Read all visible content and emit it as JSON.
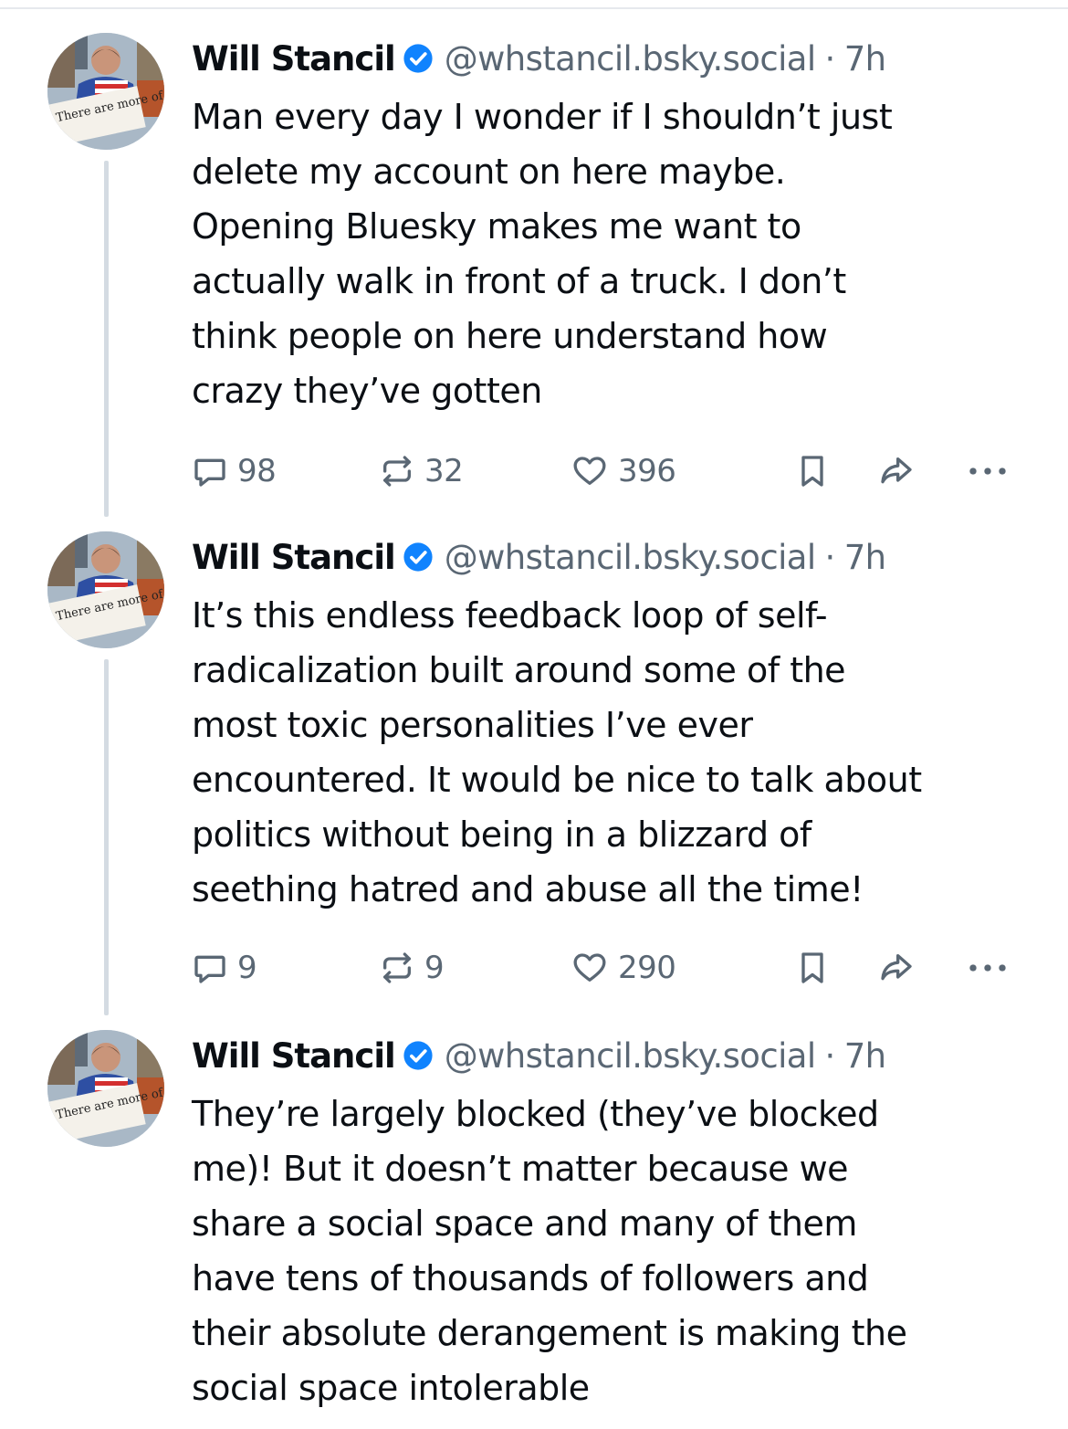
{
  "colors": {
    "text": "#0b0f14",
    "muted": "#5a6774",
    "verified_badge": "#1083fe",
    "thread_line": "#d4dbe2"
  },
  "avatar": {
    "sign_text": "There are more of us than them"
  },
  "icons": {
    "verified": "verified-check-icon",
    "reply": "reply-bubble-icon",
    "repost": "repost-arrows-icon",
    "like": "heart-icon",
    "bookmark": "bookmark-icon",
    "share": "share-arrow-icon",
    "more": "more-dots-icon"
  },
  "posts": [
    {
      "display_name": "Will Stancil",
      "handle": "@whstancil.bsky.social",
      "separator": "·",
      "time": "7h",
      "text": "Man every day I wonder if I shouldn’t just\ndelete my account on here maybe.\nOpening Bluesky makes me want to\nactually walk in front of a truck. I don’t\nthink people on here understand how\ncrazy they’ve gotten",
      "replies": "98",
      "reposts": "32",
      "likes": "396"
    },
    {
      "display_name": "Will Stancil",
      "handle": "@whstancil.bsky.social",
      "separator": "·",
      "time": "7h",
      "text": "It’s this endless feedback loop of self-\nradicalization built around some of the\nmost toxic personalities I’ve ever\nencountered. It would be nice to talk about\npolitics without being in a blizzard of\nseething hatred and abuse all the time!",
      "replies": "9",
      "reposts": "9",
      "likes": "290"
    },
    {
      "display_name": "Will Stancil",
      "handle": "@whstancil.bsky.social",
      "separator": "·",
      "time": "7h",
      "text": "They’re largely blocked (they’ve blocked\nme)! But it doesn’t matter because we\nshare a social space and many of them\nhave tens of thousands of followers and\ntheir absolute derangement is making the\nsocial space intolerable"
    }
  ]
}
